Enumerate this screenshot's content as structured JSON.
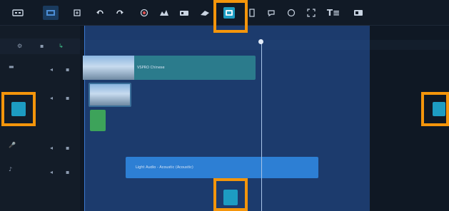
{
  "toolbar": {
    "items": [
      {
        "name": "storyboard-view-icon"
      },
      {
        "name": "timeline-view-icon"
      },
      {
        "name": "settings-icon"
      },
      {
        "name": "undo-icon"
      },
      {
        "name": "redo-icon"
      },
      {
        "name": "record-capture-icon"
      },
      {
        "name": "sound-mixer-icon"
      },
      {
        "name": "auto-music-icon"
      },
      {
        "name": "motion-tracking-icon"
      },
      {
        "name": "subtitle-editor-icon"
      },
      {
        "name": "multi-trim-icon"
      },
      {
        "name": "title-icon"
      },
      {
        "name": "chapter-icon"
      }
    ],
    "title_label": "T≡"
  },
  "timeline": {
    "clip1_label": "VSPRO Chinese",
    "audio_clip_label": "Light Audio - Acoustic (Acoustic)"
  },
  "colors": {
    "highlight": "#f4950b",
    "overlay": "#2f64b4",
    "clip_teal": "#2b7b8c",
    "audio_clip": "#2d7fd4"
  }
}
